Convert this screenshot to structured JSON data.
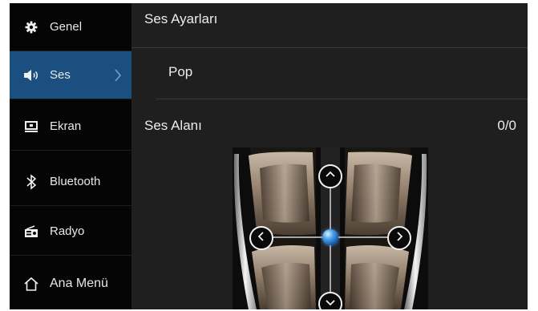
{
  "sidebar": {
    "items": [
      {
        "label": "Genel",
        "icon": "gear-icon"
      },
      {
        "label": "Ses",
        "icon": "speaker-icon",
        "active": true
      },
      {
        "label": "Ekran",
        "icon": "screen-icon"
      },
      {
        "label": "Bluetooth",
        "icon": "bluetooth-icon"
      },
      {
        "label": "Radyo",
        "icon": "radio-icon"
      },
      {
        "label": "Ana Menü",
        "icon": "home-icon"
      }
    ]
  },
  "main": {
    "title": "Ses Ayarları",
    "preset": "Pop",
    "sound_field": {
      "label": "Ses Alanı",
      "value": "0/0"
    }
  },
  "colors": {
    "active_item": "#1b4f80",
    "background": "#1f1f1f",
    "sidebar": "#050505",
    "knob": "#4aa0e8"
  }
}
